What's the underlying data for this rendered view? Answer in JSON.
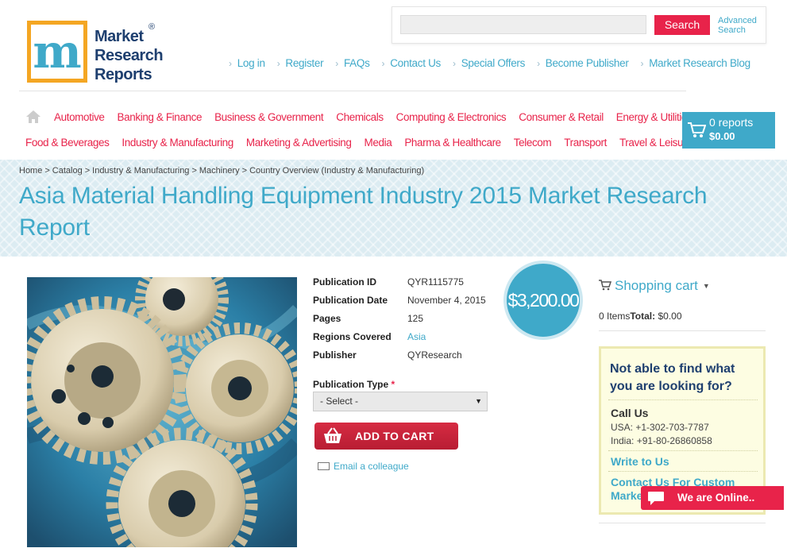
{
  "logo": {
    "letter_m": "m",
    "line1": "Market",
    "line2": "Research",
    "line3": "Reports",
    "registered": "®"
  },
  "search": {
    "placeholder": "",
    "button": "Search",
    "advanced_line1": "Advanced",
    "advanced_line2": "Search"
  },
  "top_links": [
    "Log in",
    "Register",
    "FAQs",
    "Contact Us",
    "Special Offers",
    "Become Publisher",
    "Market Research Blog"
  ],
  "nav": {
    "row1": [
      "Automotive",
      "Banking & Finance",
      "Business & Government",
      "Chemicals",
      "Computing & Electronics",
      "Consumer & Retail",
      "Energy & Utilities"
    ],
    "row2": [
      "Food & Beverages",
      "Industry & Manufacturing",
      "Marketing & Advertising",
      "Media",
      "Pharma & Healthcare",
      "Telecom",
      "Transport",
      "Travel & Leisure"
    ]
  },
  "cart": {
    "count": "0 reports",
    "total": "$0.00"
  },
  "breadcrumb": [
    "Home",
    "Catalog",
    "Industry & Manufacturing",
    "Machinery",
    "Country Overview (Industry & Manufacturing)"
  ],
  "breadcrumb_sep": ">",
  "title": "Asia Material Handling Equipment Industry 2015 Market Research Report",
  "details": [
    {
      "label": "Publication ID",
      "value": "QYR1115775"
    },
    {
      "label": "Publication Date",
      "value": "November 4, 2015"
    },
    {
      "label": "Pages",
      "value": "125"
    },
    {
      "label": "Regions Covered",
      "value": "Asia"
    },
    {
      "label": "Publisher",
      "value": "QYResearch"
    }
  ],
  "price": "$3,200.00",
  "publication_type": {
    "label": "Publication Type",
    "required_mark": "*",
    "selected": "- Select -"
  },
  "add_to_cart": "ADD TO CART",
  "email_colleague": "Email a colleague",
  "sidebar": {
    "shopping_cart": "Shopping cart",
    "items": "0 Items",
    "total_label": "Total:",
    "total_value": "$0.00",
    "help_title": "Not able to find what you are looking for?",
    "call_us": "Call Us",
    "usa": "USA: +1-302-703-7787",
    "india": "India: +91-80-26860858",
    "write_to_us": "Write to Us",
    "contact_custom": "Contact Us For Custom Market"
  },
  "chat": {
    "label": "We are Online.."
  },
  "colors": {
    "accent": "#3fa9c9",
    "brand_red": "#e8234a",
    "navy": "#1e3f6f",
    "logo_orange": "#f4a623"
  },
  "icons": [
    "home-icon",
    "cart-icon",
    "mail-icon",
    "chat-icon",
    "dropdown-arrow-icon"
  ]
}
